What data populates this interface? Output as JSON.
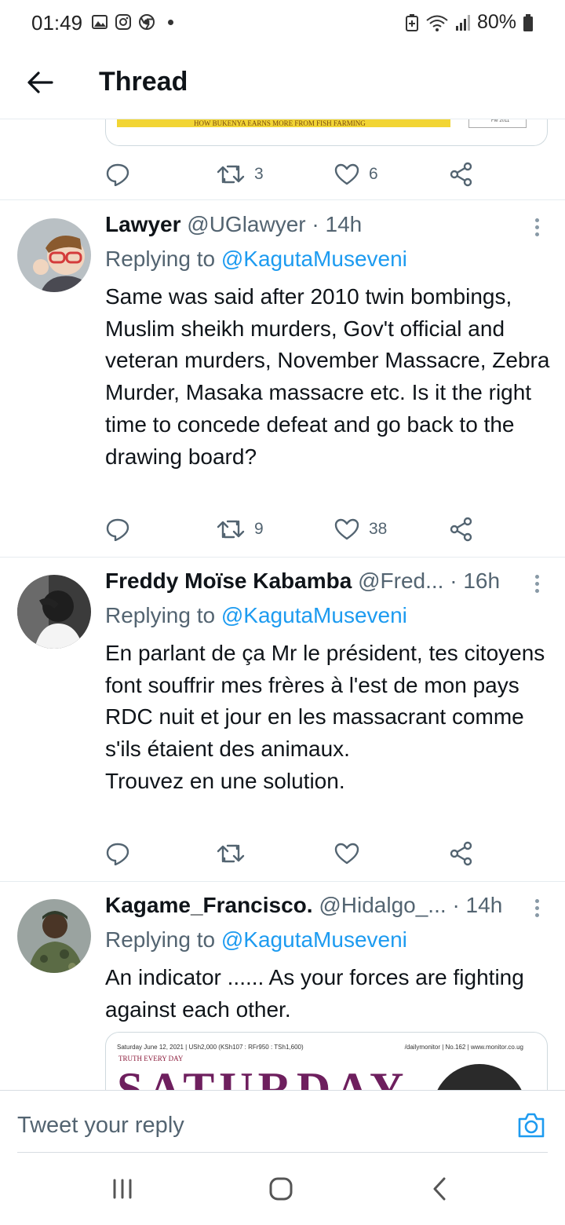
{
  "status_bar": {
    "time": "01:49",
    "battery": "80%",
    "icons": [
      "gallery-icon",
      "instagram-icon",
      "chrome-icon",
      "notification-dot",
      "battery-saver-icon",
      "wifi-icon",
      "signal-icon",
      "battery-icon"
    ]
  },
  "header": {
    "back_icon": "arrow-left-icon",
    "title": "Thread"
  },
  "top_tweet": {
    "card_caption": "HOW BUKENYA EARNS MORE FROM FISH FARMING",
    "card_box_text": "FM 2011",
    "actions": {
      "replies": "",
      "retweets": "3",
      "likes": "6"
    }
  },
  "tweets": [
    {
      "name": "Lawyer",
      "handle": "@UGlawyer",
      "time": "14h",
      "reply_prefix": "Replying to",
      "reply_to": "@KagutaMuseveni",
      "text": "Same was said after 2010 twin bombings, Muslim sheikh murders, Gov't official and veteran murders, November Massacre, Zebra Murder, Masaka massacre etc. Is it the right time to concede defeat and go back to the drawing board?",
      "retweets": "9",
      "likes": "38"
    },
    {
      "name": "Freddy Moïse Kabamba",
      "handle": "@Fred...",
      "time": "16h",
      "reply_prefix": "Replying to",
      "reply_to": "@KagutaMuseveni",
      "text": "En parlant de ça Mr le président, tes citoyens font souffrir mes frères à l'est de mon pays RDC nuit et jour en les massacrant comme s'ils étaient des animaux.\nTrouvez en une solution.",
      "retweets": "",
      "likes": ""
    },
    {
      "name": "Kagame_Francisco.",
      "handle": "@Hidalgo_...",
      "time": "14h",
      "reply_prefix": "Replying to",
      "reply_to": "@KagutaMuseveni",
      "text": "An indicator ...... As your forces are fighting against each other.",
      "media": {
        "date_line": "Saturday June 12, 2021 | USh2,000 (KSh107 : RFr950 : TSh1,600)",
        "right_line": "/dailymonitor | No.162 | www.monitor.co.ug",
        "tag": "TRUTH EVERY DAY",
        "title": "SATURDAY"
      }
    }
  ],
  "reply_bar": {
    "placeholder": "Tweet your reply",
    "camera_icon": "camera-icon"
  },
  "nav_bar": {
    "buttons": [
      "recents-icon",
      "home-icon",
      "back-icon"
    ]
  },
  "colors": {
    "link": "#1d9bf0",
    "secondary_text": "#536471",
    "divider": "#e6ecf0"
  }
}
